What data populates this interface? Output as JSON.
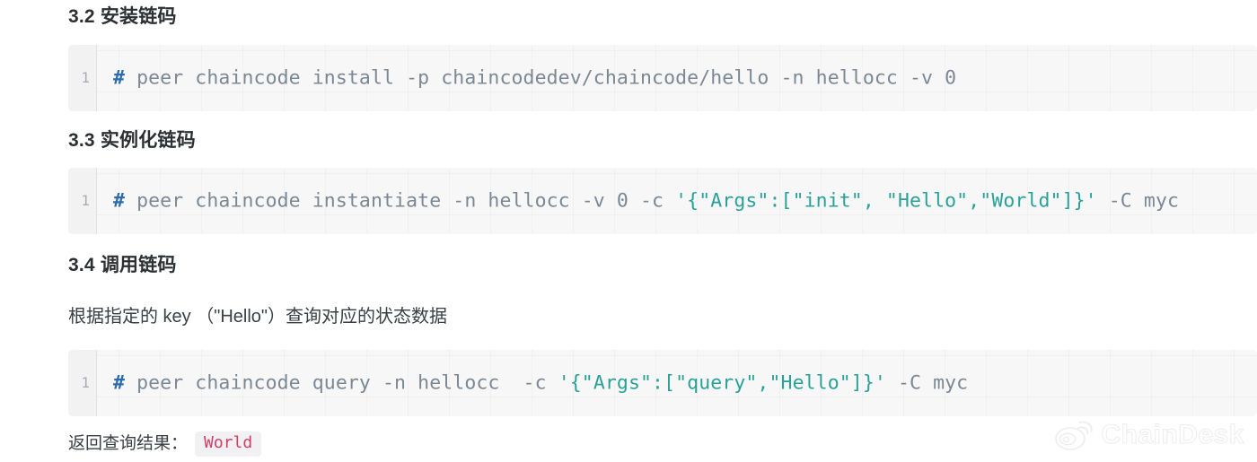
{
  "document": {
    "sections": [
      {
        "heading": "3.2 安装链码",
        "code": {
          "line_number": "1",
          "tokens": [
            {
              "type": "prompt",
              "text": "#"
            },
            {
              "type": "plain",
              "text": " peer chaincode install -p chaincodedev/chaincode/hello -n hellocc -v 0"
            }
          ]
        }
      },
      {
        "heading": "3.3 实例化链码",
        "code": {
          "line_number": "1",
          "tokens": [
            {
              "type": "prompt",
              "text": "#"
            },
            {
              "type": "plain",
              "text": " peer chaincode instantiate -n hellocc -v 0 -c "
            },
            {
              "type": "string",
              "text": "'{\"Args\":[\"init\", \"Hello\",\"World\"]}'"
            },
            {
              "type": "plain",
              "text": " -C myc"
            }
          ]
        }
      },
      {
        "heading": "3.4 调用链码",
        "paragraph": "根据指定的 key （\"Hello\"）查询对应的状态数据",
        "code": {
          "line_number": "1",
          "tokens": [
            {
              "type": "prompt",
              "text": "#"
            },
            {
              "type": "plain",
              "text": " peer chaincode query -n hellocc  -c "
            },
            {
              "type": "string",
              "text": "'{\"Args\":[\"query\",\"Hello\"]}'"
            },
            {
              "type": "plain",
              "text": " -C myc"
            }
          ]
        }
      }
    ],
    "result": {
      "label": "返回查询结果：",
      "value": "World"
    },
    "watermark": {
      "icon": "weibo-logo-icon",
      "text": "ChainDesk"
    },
    "colors": {
      "heading": "#2c3033",
      "body": "#3a3f44",
      "code_plain": "#7b8894",
      "code_prompt": "#2c6bac",
      "code_string": "#2aa198",
      "inline_code": "#d23d63",
      "code_background": "#f7f7f8",
      "inline_code_background": "#f1f1f3"
    }
  }
}
